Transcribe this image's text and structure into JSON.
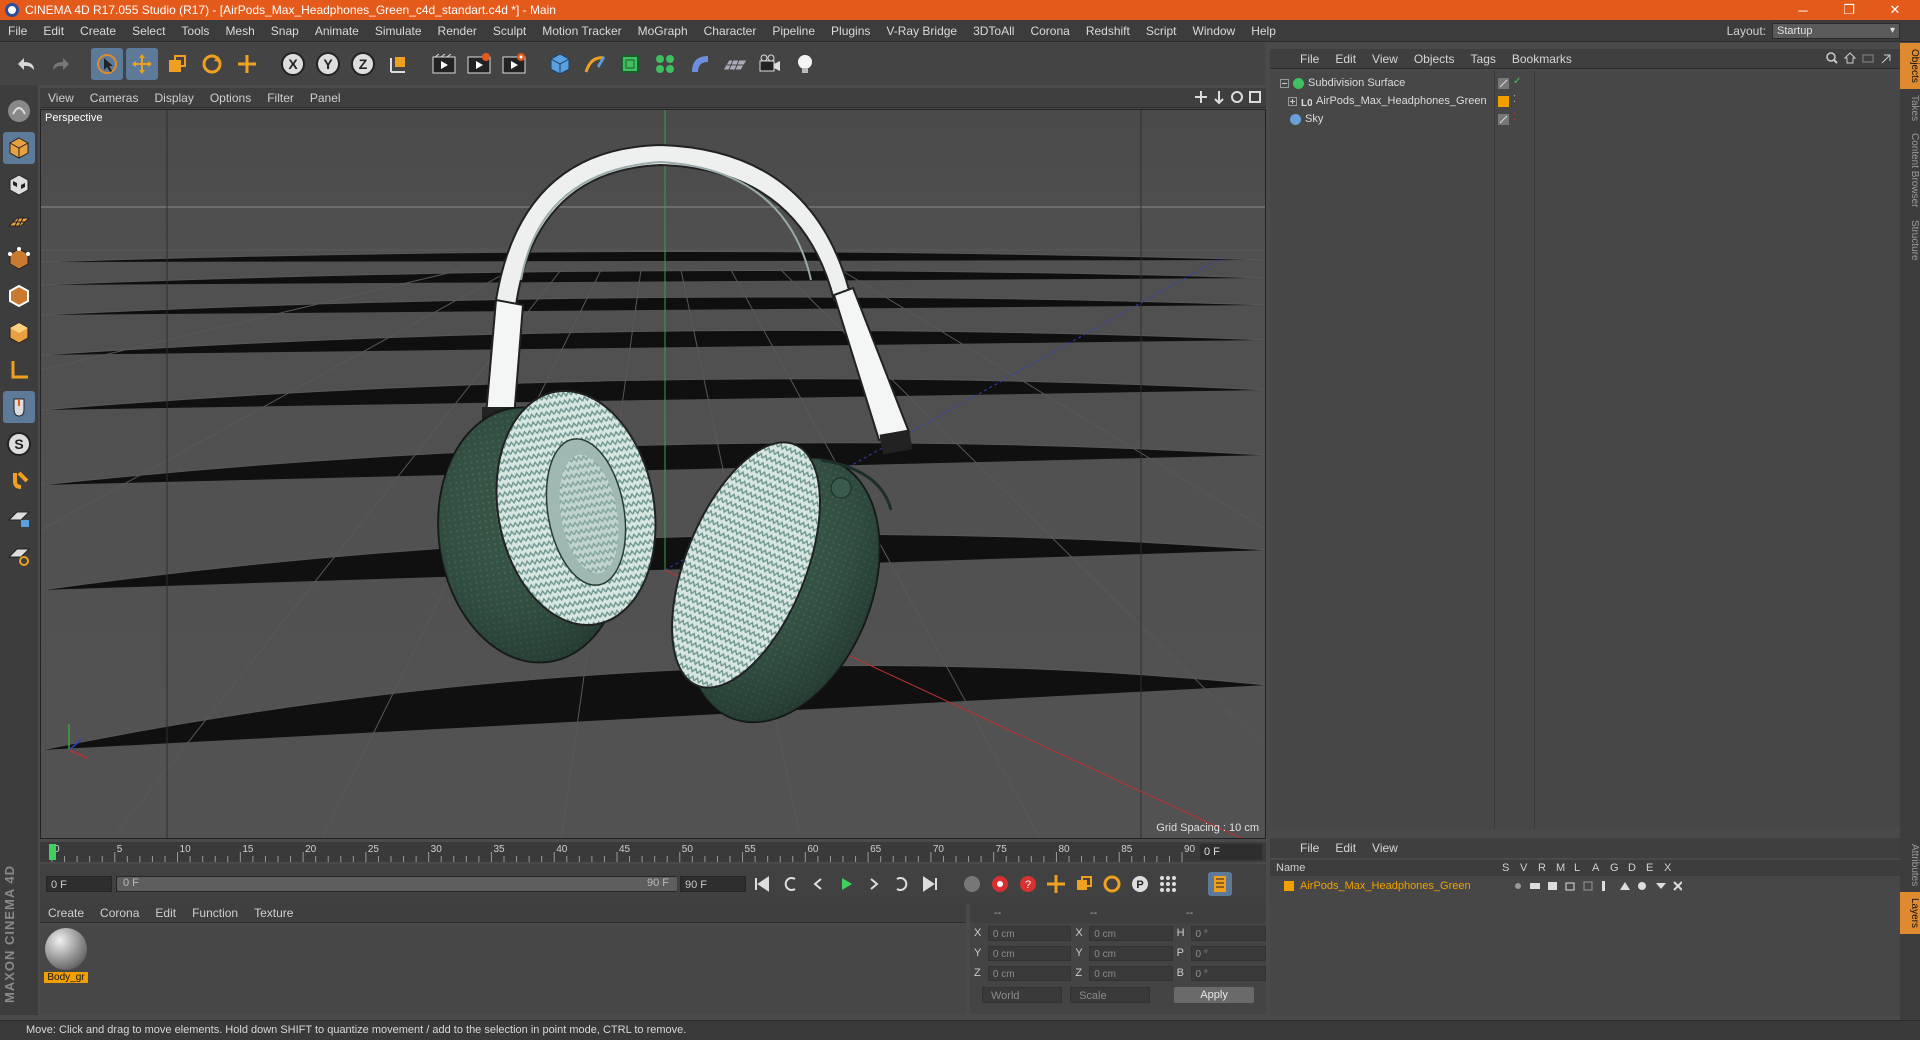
{
  "window": {
    "title": "CINEMA 4D R17.055 Studio (R17) - [AirPods_Max_Headphones_Green_c4d_standart.c4d *] - Main",
    "controls": [
      "─",
      "❐",
      "✕"
    ]
  },
  "menu": [
    "File",
    "Edit",
    "Create",
    "Select",
    "Tools",
    "Mesh",
    "Snap",
    "Animate",
    "Simulate",
    "Render",
    "Sculpt",
    "Motion Tracker",
    "MoGraph",
    "Character",
    "Pipeline",
    "Plugins",
    "V-Ray Bridge",
    "3DToAll",
    "Corona",
    "Redshift",
    "Script",
    "Window",
    "Help"
  ],
  "layout": {
    "label": "Layout:",
    "value": "Startup"
  },
  "viewport": {
    "menu": [
      "View",
      "Cameras",
      "Display",
      "Options",
      "Filter",
      "Panel"
    ],
    "label": "Perspective",
    "grid_spacing": "Grid Spacing : 10 cm"
  },
  "timeline": {
    "ticks": [
      "0",
      "5",
      "10",
      "15",
      "20",
      "25",
      "30",
      "35",
      "40",
      "45",
      "50",
      "55",
      "60",
      "65",
      "70",
      "75",
      "80",
      "85",
      "90"
    ],
    "current_frame": "0 F",
    "start_field": "0 F",
    "range_start": "0 F",
    "range_end": "90 F",
    "end_field": "90 F"
  },
  "materials": {
    "menu": [
      "Create",
      "Corona",
      "Edit",
      "Function",
      "Texture"
    ],
    "items": [
      {
        "label": "Body_gr"
      }
    ]
  },
  "coordinates": {
    "header": [
      "--",
      "--",
      "--"
    ],
    "rows": [
      {
        "a1": "X",
        "v1": "0 cm",
        "a2": "X",
        "v2": "0 cm",
        "a3": "H",
        "v3": "0 °"
      },
      {
        "a1": "Y",
        "v1": "0 cm",
        "a2": "Y",
        "v2": "0 cm",
        "a3": "P",
        "v3": "0 °"
      },
      {
        "a1": "Z",
        "v1": "0 cm",
        "a2": "Z",
        "v2": "0 cm",
        "a3": "B",
        "v3": "0 °"
      }
    ],
    "mode1": "World",
    "mode2": "Scale",
    "apply": "Apply"
  },
  "object_manager": {
    "menu": [
      "File",
      "Edit",
      "View",
      "Objects",
      "Tags",
      "Bookmarks"
    ],
    "objects": [
      {
        "name": "Subdivision Surface",
        "color": "#3fbf5f"
      },
      {
        "name": "AirPods_Max_Headphones_Green",
        "color": "#cfcfcf"
      },
      {
        "name": "Sky",
        "color": "#6a9fd8"
      }
    ]
  },
  "side_tabs": [
    "Objects",
    "Takes",
    "Content Browser",
    "Structure"
  ],
  "side_tabs_lower": [
    "Attributes",
    "Layers"
  ],
  "layer_manager": {
    "menu": [
      "File",
      "Edit",
      "View"
    ],
    "columns": [
      "Name",
      "S",
      "V",
      "R",
      "M",
      "L",
      "A",
      "G",
      "D",
      "E",
      "X"
    ],
    "layer": "AirPods_Max_Headphones_Green"
  },
  "status": "Move: Click and drag to move elements. Hold down SHIFT to quantize movement / add to the selection in point mode, CTRL to remove.",
  "colors": {
    "accent": "#e35a1b",
    "highlight": "#5d7a99",
    "material_label": "#f2a000"
  }
}
